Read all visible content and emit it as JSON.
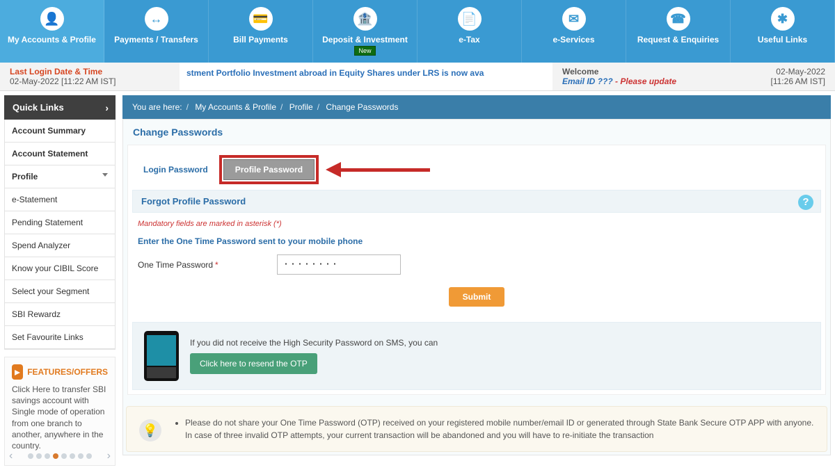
{
  "nav": {
    "items": [
      {
        "label": "My Accounts & Profile",
        "icon": "👤",
        "active": true
      },
      {
        "label": "Payments / Transfers",
        "icon": "↔"
      },
      {
        "label": "Bill Payments",
        "icon": "💳"
      },
      {
        "label": "Deposit & Investment",
        "icon": "🏦",
        "badge": "New"
      },
      {
        "label": "e-Tax",
        "icon": "📄"
      },
      {
        "label": "e-Services",
        "icon": "✉"
      },
      {
        "label": "Request & Enquiries",
        "icon": "☎"
      },
      {
        "label": "Useful Links",
        "icon": "✱"
      }
    ]
  },
  "infobar": {
    "last_login_label": "Last Login Date & Time",
    "last_login_value": "02-May-2022 [11:22 AM IST]",
    "ticker": "stment Portfolio Investment abroad in Equity Shares under LRS is now ava",
    "welcome": "Welcome",
    "email_prefix": "Email ID ???",
    "please_update": "- Please update",
    "now_date": "02-May-2022",
    "now_time": "[11:26 AM IST]"
  },
  "sidebar": {
    "title": "Quick Links",
    "items": [
      {
        "label": "Account Summary",
        "hi": true
      },
      {
        "label": "Account Statement",
        "hi": true
      },
      {
        "label": "Profile",
        "hi": true,
        "caret": true
      },
      {
        "label": "e-Statement"
      },
      {
        "label": "Pending Statement"
      },
      {
        "label": "Spend Analyzer"
      },
      {
        "label": "Know your CIBIL Score"
      },
      {
        "label": "Select your Segment"
      },
      {
        "label": "SBI Rewardz"
      },
      {
        "label": "Set Favourite Links"
      }
    ],
    "promo": {
      "heading": "FEATURES/OFFERS",
      "text": "Click Here to transfer SBI savings account with Single mode of operation from one branch to another, anywhere in the country."
    }
  },
  "crumb": {
    "prefix": "You are here:",
    "items": [
      "My Accounts & Profile",
      "Profile",
      "Change Passwords"
    ]
  },
  "panel": {
    "title": "Change Passwords",
    "tabs": {
      "login": "Login Password",
      "profile": "Profile Password"
    },
    "section": "Forgot Profile Password",
    "mandatory": "Mandatory fields are marked in asterisk (*)",
    "instruction": "Enter the One Time Password sent to your mobile phone",
    "otp_label": "One Time Password",
    "otp_value": "········",
    "submit": "Submit",
    "resend_text": "If you did not receive the High Security Password on SMS, you can",
    "resend_btn": "Click here to resend the OTP",
    "warning": "Please do not share your One Time Password (OTP) received on your registered mobile number/email ID or generated through State Bank Secure OTP APP with anyone. In case of three invalid OTP attempts, your current transaction will be abandoned and you will have to re-initiate the transaction"
  }
}
